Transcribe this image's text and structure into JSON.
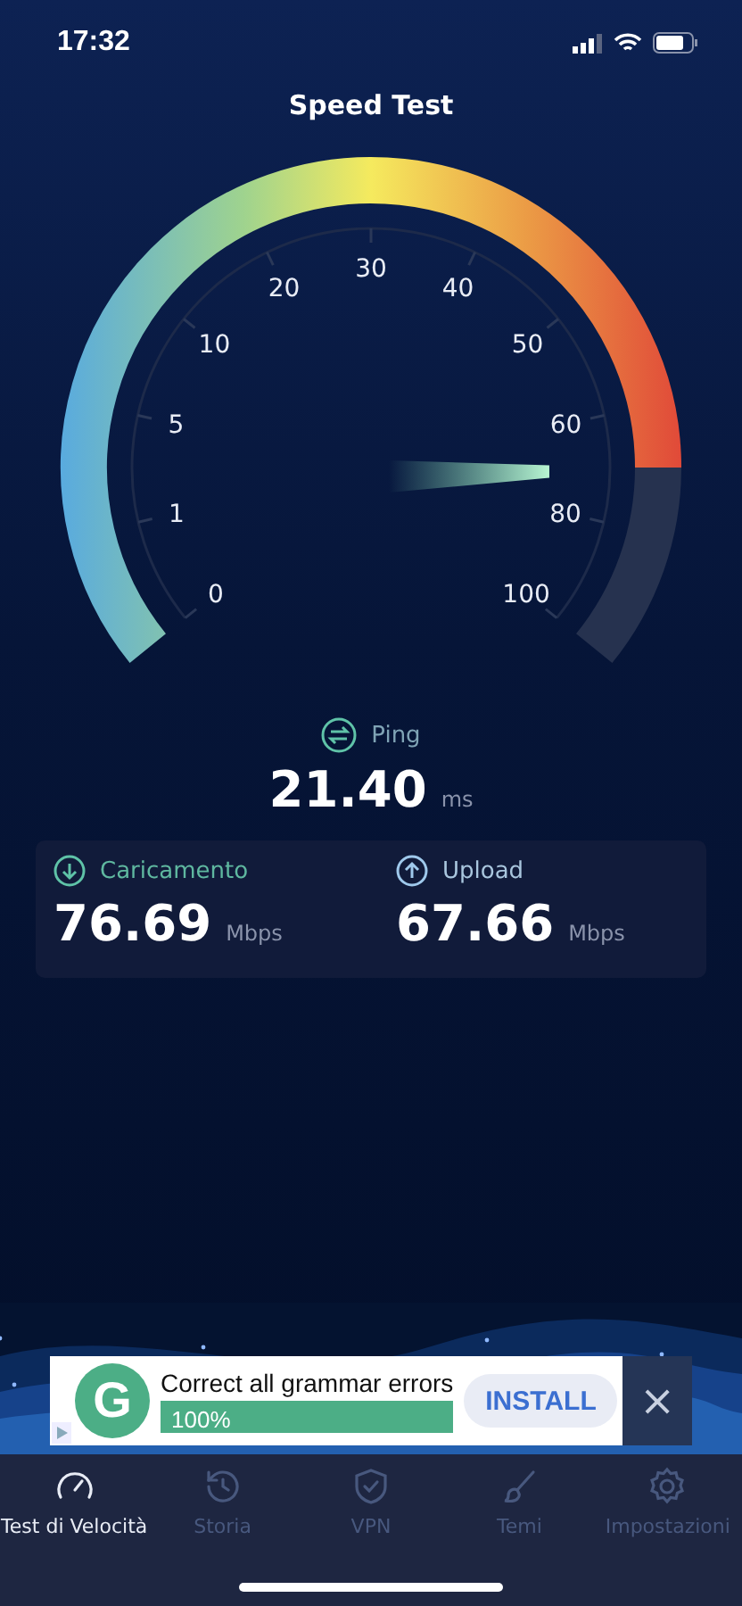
{
  "status_bar": {
    "time": "17:32"
  },
  "title": "Speed Test",
  "gauge": {
    "scale": [
      "0",
      "1",
      "5",
      "10",
      "20",
      "30",
      "40",
      "50",
      "60",
      "80",
      "100"
    ]
  },
  "ping": {
    "label": "Ping",
    "value": "21.40",
    "unit": "ms"
  },
  "results": [
    {
      "kind": "download",
      "label": "Caricamento",
      "value": "76.69",
      "unit": "Mbps"
    },
    {
      "kind": "upload",
      "label": "Upload",
      "value": "67.66",
      "unit": "Mbps"
    }
  ],
  "ad": {
    "logo": "G",
    "headline": "Correct all grammar errors",
    "progress": {
      "level": 1,
      "text": "100%"
    },
    "button": "INSTALL",
    "close": "×"
  },
  "tabs": [
    {
      "kind": "gauge",
      "label": "Test di Velocità",
      "selected": true
    },
    {
      "kind": "history",
      "label": "Storia",
      "selected": false
    },
    {
      "kind": "shield",
      "label": "VPN",
      "selected": false
    },
    {
      "kind": "brush",
      "label": "Temi",
      "selected": false
    },
    {
      "kind": "gear",
      "label": "Impostazioni",
      "selected": false
    }
  ]
}
